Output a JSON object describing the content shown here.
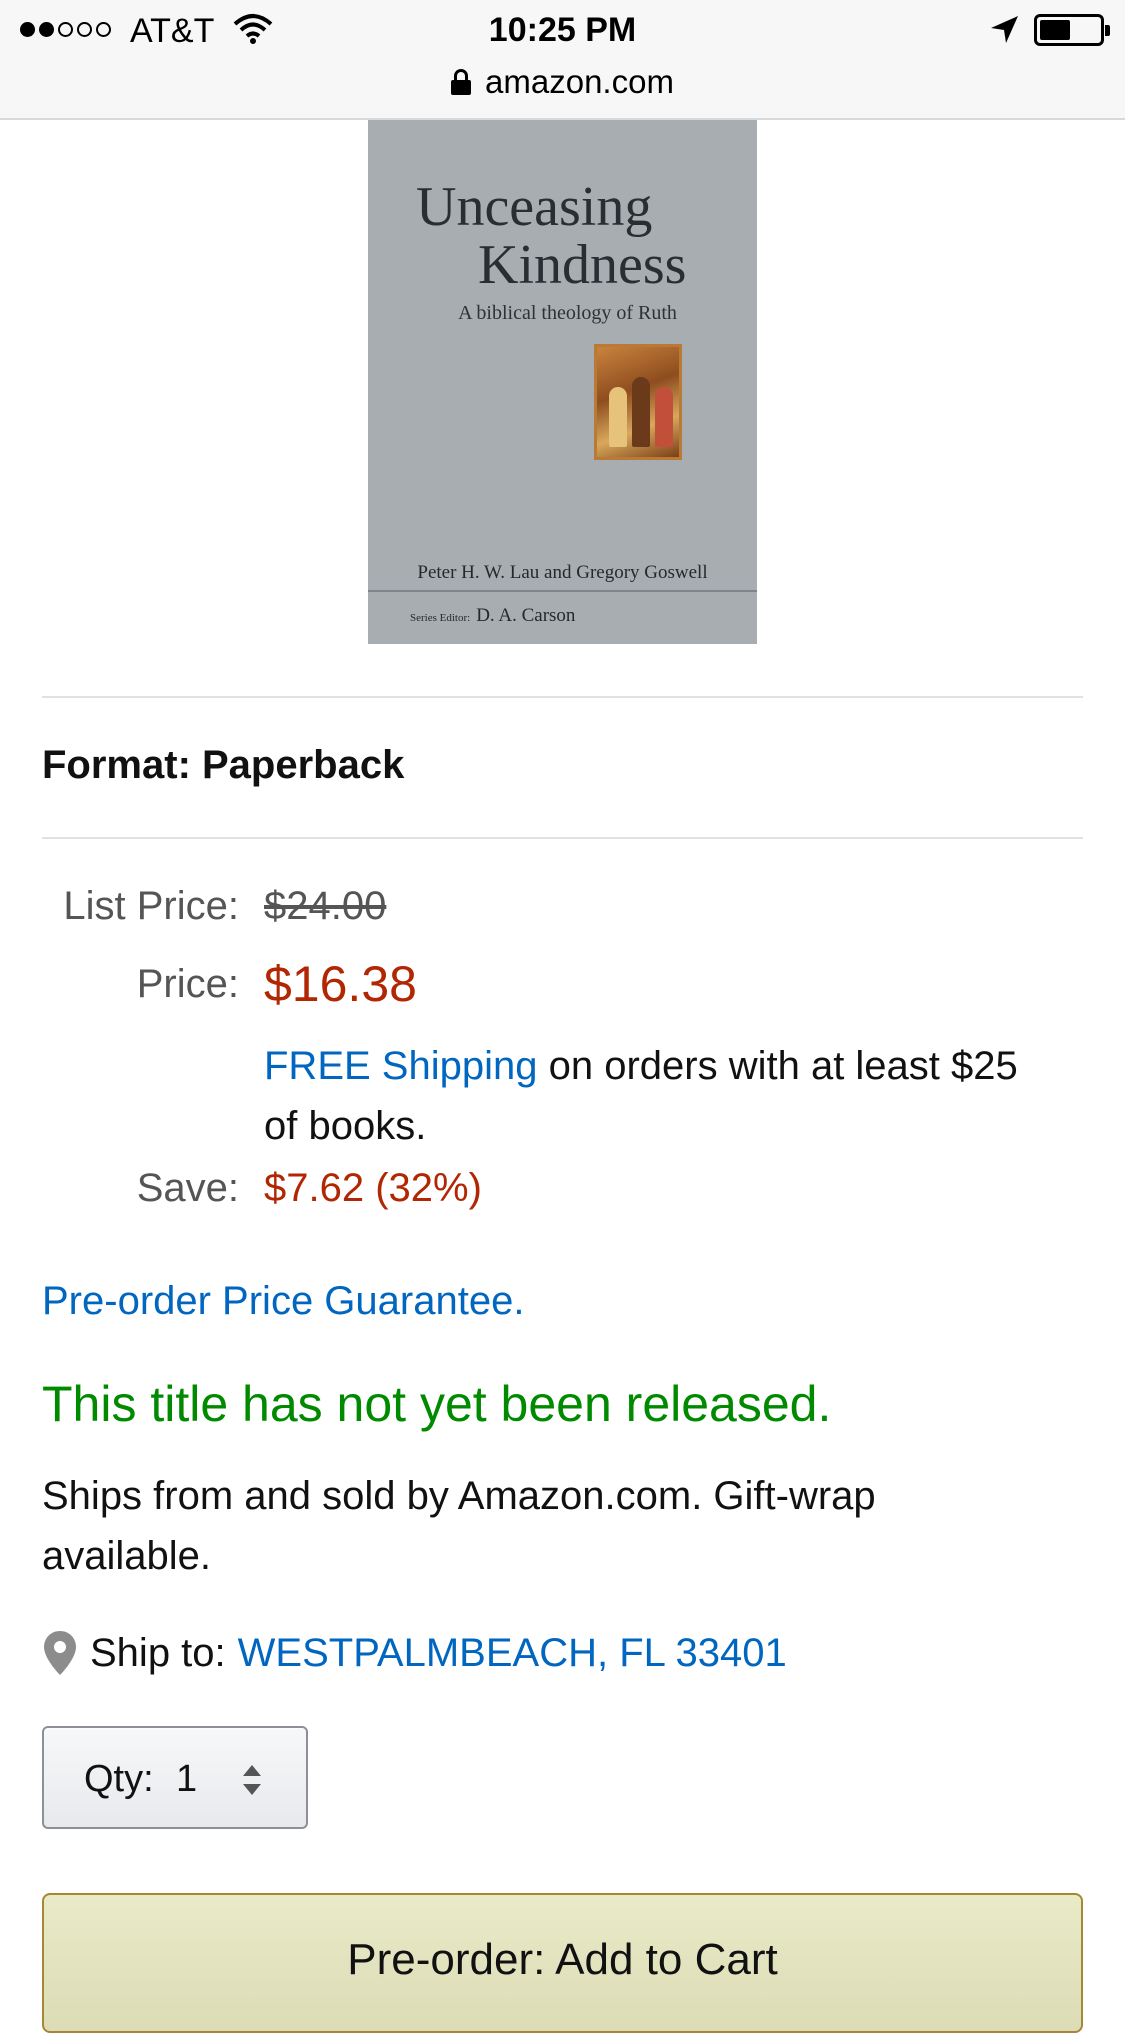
{
  "status_bar": {
    "carrier": "AT&T",
    "time": "10:25 PM",
    "url": "amazon.com"
  },
  "cover": {
    "title_line1": "Unceasing",
    "title_line2": "Kindness",
    "subtitle": "A biblical theology of Ruth",
    "authors": "Peter H. W. Lau and Gregory Goswell",
    "series_editor_label": "Series Editor:",
    "series_editor": "D. A. Carson"
  },
  "product": {
    "format": "Format: Paperback",
    "list_price_label": "List Price:",
    "list_price": "$24.00",
    "price_label": "Price:",
    "price": "$16.38",
    "shipping_link": "FREE Shipping",
    "shipping_rest": " on orders with at least $25 of books.",
    "save_label": "Save:",
    "save_value": "$7.62 (32%)",
    "guarantee_link": "Pre-order Price Guarantee.",
    "availability": "This title has not yet been released.",
    "ships_from": "Ships from and sold by Amazon.com. Gift-wrap available.",
    "ship_to_label": "Ship to:",
    "ship_to_location": "WESTPALMBEACH, FL 33401",
    "qty_label": "Qty:",
    "qty_value": "1",
    "add_to_cart": "Pre-order: Add to Cart"
  },
  "icons": {
    "lock": "lock-icon",
    "wifi": "wifi-icon",
    "location_arrow": "location-arrow-icon",
    "battery": "battery-icon",
    "pin": "map-pin-icon",
    "stepper": "up-down-stepper-icon"
  },
  "colors": {
    "price_red": "#b12704",
    "link_blue": "#0066c0",
    "availability_green": "#008a00",
    "cart_button": "#e4e4bf"
  }
}
